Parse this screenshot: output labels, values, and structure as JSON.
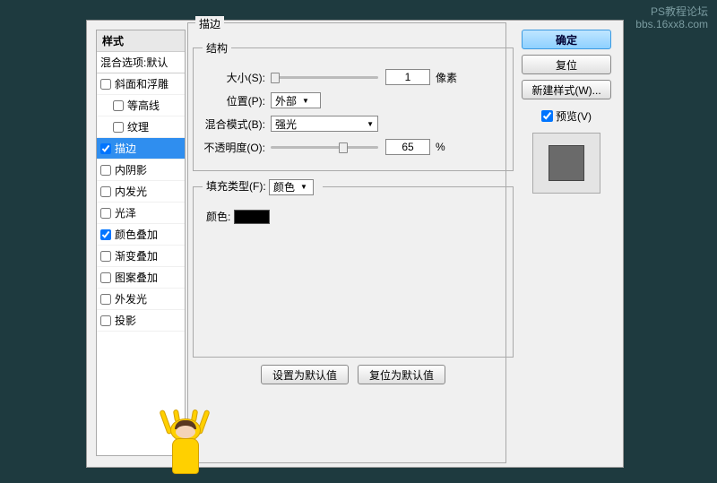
{
  "watermark": {
    "line1": "PS教程论坛",
    "line2": "bbs.16xx8.com"
  },
  "sidebar": {
    "header": "样式",
    "blend": "混合选项:默认",
    "items": [
      {
        "label": "斜面和浮雕",
        "checked": false,
        "indent": false,
        "active": false
      },
      {
        "label": "等高线",
        "checked": false,
        "indent": true,
        "active": false
      },
      {
        "label": "纹理",
        "checked": false,
        "indent": true,
        "active": false
      },
      {
        "label": "描边",
        "checked": true,
        "indent": false,
        "active": true
      },
      {
        "label": "内阴影",
        "checked": false,
        "indent": false,
        "active": false
      },
      {
        "label": "内发光",
        "checked": false,
        "indent": false,
        "active": false
      },
      {
        "label": "光泽",
        "checked": false,
        "indent": false,
        "active": false
      },
      {
        "label": "颜色叠加",
        "checked": true,
        "indent": false,
        "active": false
      },
      {
        "label": "渐变叠加",
        "checked": false,
        "indent": false,
        "active": false
      },
      {
        "label": "图案叠加",
        "checked": false,
        "indent": false,
        "active": false
      },
      {
        "label": "外发光",
        "checked": false,
        "indent": false,
        "active": false
      },
      {
        "label": "投影",
        "checked": false,
        "indent": false,
        "active": false
      }
    ]
  },
  "main": {
    "stroke_legend": "描边",
    "struct_legend": "结构",
    "size_label": "大小(S):",
    "size_value": "1",
    "size_unit": "像素",
    "position_label": "位置(P):",
    "position_value": "外部",
    "blend_label": "混合模式(B):",
    "blend_value": "强光",
    "opacity_label": "不透明度(O):",
    "opacity_value": "65",
    "opacity_unit": "%",
    "fill_legend_label": "填充类型(F):",
    "fill_value": "颜色",
    "color_label": "颜色:",
    "default_btn": "设置为默认值",
    "reset_btn": "复位为默认值"
  },
  "right": {
    "ok": "确定",
    "cancel": "复位",
    "newstyle": "新建样式(W)...",
    "preview": "预览(V)"
  }
}
